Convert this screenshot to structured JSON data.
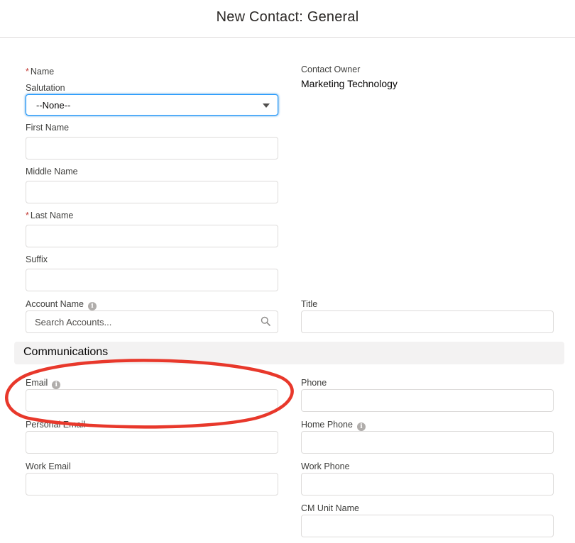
{
  "header": {
    "title": "New Contact: General"
  },
  "name_section": {
    "name_label": "Name",
    "required_marker": "*",
    "salutation": {
      "label": "Salutation",
      "value": "--None--"
    },
    "first_name": {
      "label": "First Name",
      "value": ""
    },
    "middle_name": {
      "label": "Middle Name",
      "value": ""
    },
    "last_name": {
      "label": "Last Name",
      "value": ""
    },
    "suffix": {
      "label": "Suffix",
      "value": ""
    }
  },
  "owner": {
    "label": "Contact Owner",
    "value": "Marketing Technology"
  },
  "account": {
    "label": "Account Name",
    "placeholder": "Search Accounts..."
  },
  "title_field": {
    "label": "Title",
    "value": ""
  },
  "communications": {
    "heading": "Communications",
    "email": {
      "label": "Email"
    },
    "personal_email": {
      "label": "Personal Email"
    },
    "work_email": {
      "label": "Work Email"
    },
    "phone": {
      "label": "Phone"
    },
    "home_phone": {
      "label": "Home Phone"
    },
    "work_phone": {
      "label": "Work Phone"
    },
    "cm_unit_name": {
      "label": "CM Unit Name"
    }
  },
  "icons": {
    "info": "info-icon",
    "search": "search-icon",
    "caret": "chevron-down-icon",
    "info_glyph": "i"
  },
  "colors": {
    "annotation": "#e8382b",
    "required": "#c23934",
    "focus": "#1b96ff"
  }
}
